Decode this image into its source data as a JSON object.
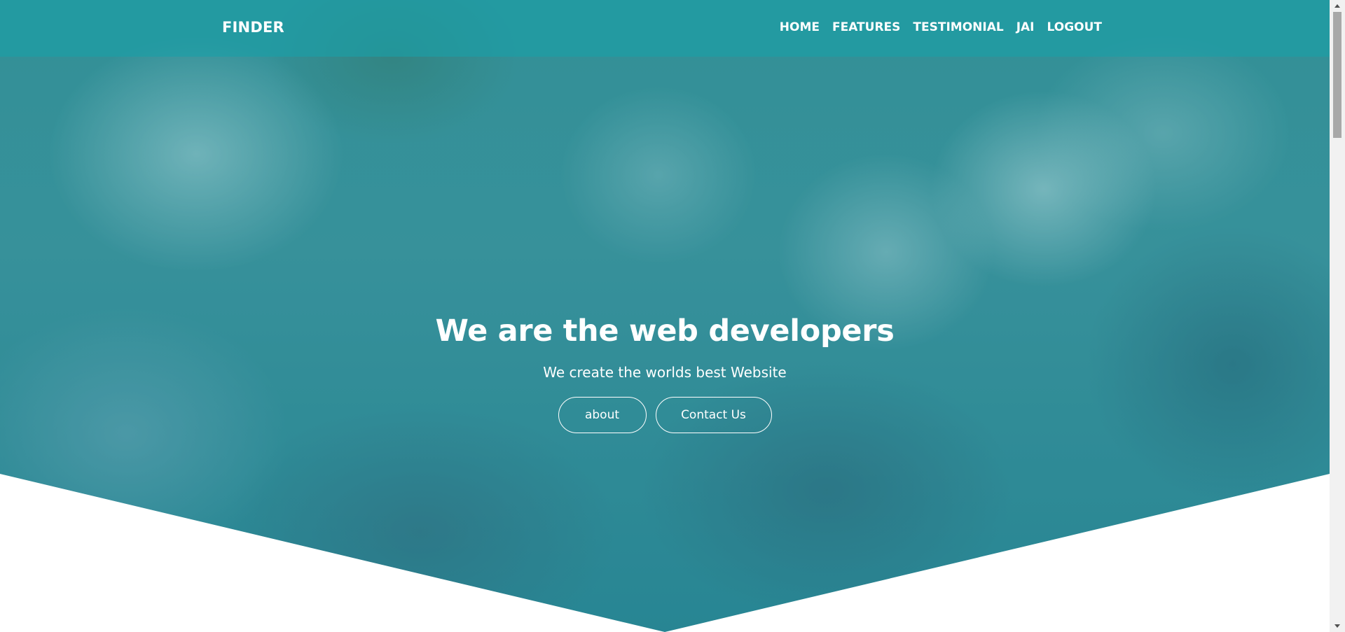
{
  "navbar": {
    "brand": "FINDER",
    "links": [
      {
        "label": "HOME"
      },
      {
        "label": "FEATURES"
      },
      {
        "label": "TESTIMONIAL"
      },
      {
        "label": "JAI"
      },
      {
        "label": "LOGOUT"
      }
    ]
  },
  "hero": {
    "title": "We are the web developers",
    "subtitle": "We create the worlds best Website",
    "buttons": {
      "about": "about",
      "contact": "Contact Us"
    },
    "background_icon": "photo-children-group",
    "overlay_color": "#1a96a0"
  },
  "scrollbar": {
    "up_icon": "triangle-up-icon",
    "down_icon": "triangle-down-icon"
  }
}
